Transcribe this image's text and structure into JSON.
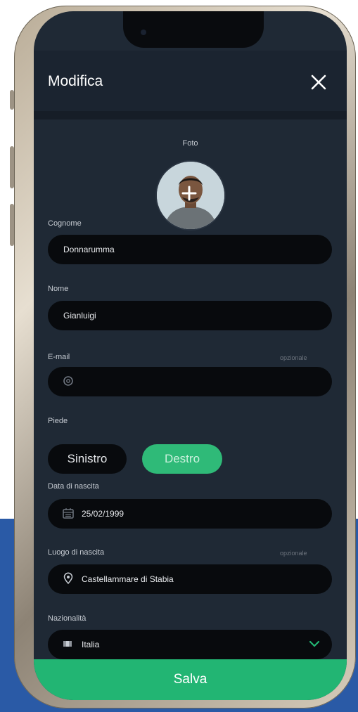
{
  "header": {
    "title": "Modifica"
  },
  "photo": {
    "label": "Foto"
  },
  "fields": {
    "cognome": {
      "label": "Cognome",
      "value": "Donnarumma"
    },
    "nome": {
      "label": "Nome",
      "value": "Gianluigi"
    },
    "email": {
      "label": "E-mail",
      "hint": "opzionale",
      "value": ""
    },
    "piede": {
      "label": "Piede",
      "options": [
        "Sinistro",
        "Destro"
      ],
      "selected": "Destro"
    },
    "data_nascita": {
      "label": "Data di nascita",
      "value": "25/02/1999"
    },
    "luogo_nascita": {
      "label": "Luogo di nascita",
      "hint": "opzionale",
      "value": "Castellammare di Stabia"
    },
    "nazionalita": {
      "label": "Nazionalità",
      "value": "Italia"
    }
  },
  "footer": {
    "save_label": "Salva"
  },
  "icons": {
    "close": "close-icon",
    "add_photo": "plus-icon",
    "email": "at-icon",
    "date": "calendar-icon",
    "place": "location-pin-icon",
    "nationality": "flag-icon",
    "dropdown": "chevron-down-icon"
  },
  "colors": {
    "background": "#1f2935",
    "field": "#080a0d",
    "accent": "#22b573",
    "page_bg_blue": "#2a5aa6"
  }
}
